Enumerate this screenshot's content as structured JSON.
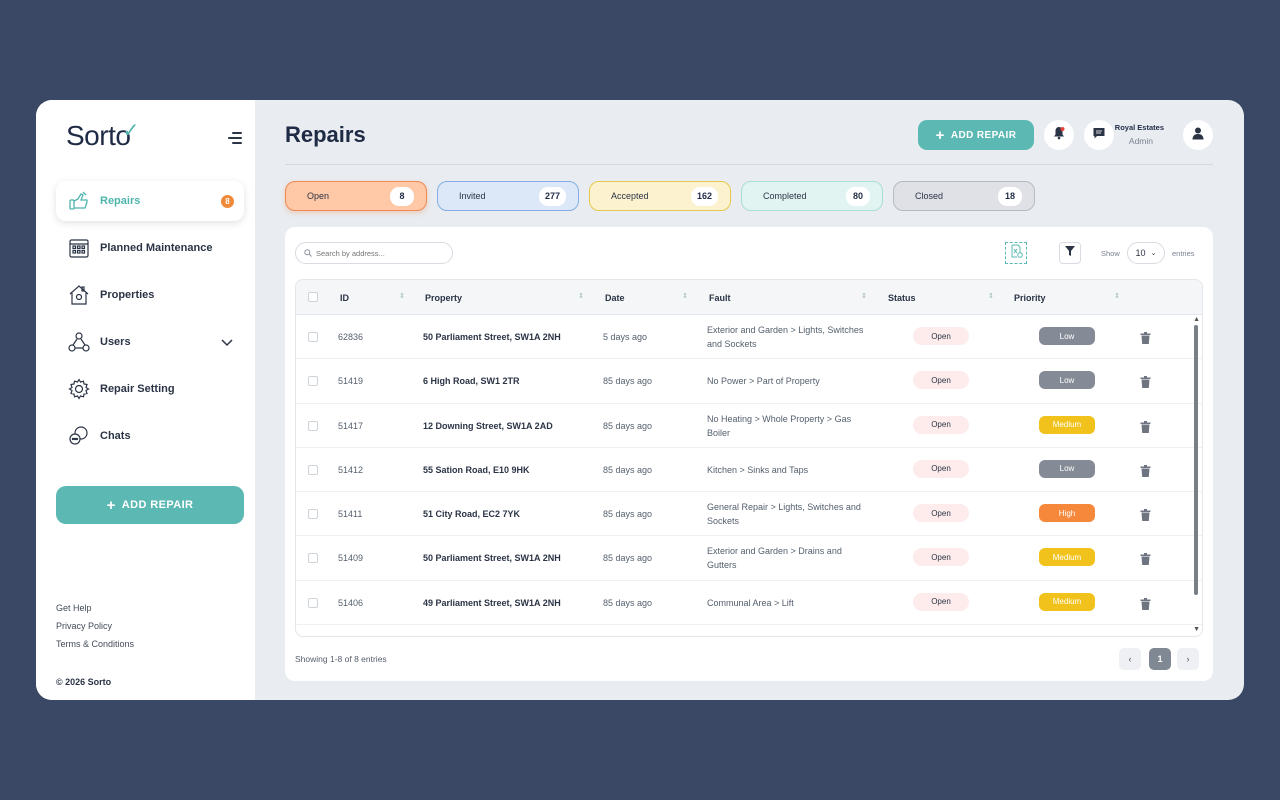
{
  "brand": {
    "name": "Sorto"
  },
  "sidebar": {
    "items": [
      {
        "label": "Repairs",
        "badge": "8",
        "icon": "repair-hand-icon"
      },
      {
        "label": "Planned Maintenance",
        "icon": "calendar-icon"
      },
      {
        "label": "Properties",
        "icon": "house-icon"
      },
      {
        "label": "Users",
        "icon": "users-network-icon"
      },
      {
        "label": "Repair Setting",
        "icon": "gear-icon"
      },
      {
        "label": "Chats",
        "icon": "chat-bubbles-icon"
      }
    ],
    "add_label": "ADD REPAIR",
    "footer": {
      "help": "Get Help",
      "privacy": "Privacy Policy",
      "terms": "Terms & Conditions"
    },
    "copyright": "© 2026 Sorto"
  },
  "header": {
    "title": "Repairs",
    "add_label": "ADD REPAIR",
    "user_name": "Royal Estates",
    "user_role": "Admin"
  },
  "stats": [
    {
      "label": "Open",
      "count": "8"
    },
    {
      "label": "Invited",
      "count": "277"
    },
    {
      "label": "Accepted",
      "count": "162"
    },
    {
      "label": "Completed",
      "count": "80"
    },
    {
      "label": "Closed",
      "count": "18"
    }
  ],
  "toolbar": {
    "search_placeholder": "Search by address...",
    "show_label": "Show",
    "page_size": "10",
    "entries_label": "entries"
  },
  "table": {
    "columns": [
      "ID",
      "Property",
      "Date",
      "Fault",
      "Status",
      "Priority"
    ],
    "rows": [
      {
        "id": "62836",
        "property": "50 Parliament Street, SW1A 2NH",
        "date": "5 days ago",
        "fault": "Exterior and Garden > Lights, Switches and Sockets",
        "status": "Open",
        "priority": "Low"
      },
      {
        "id": "51419",
        "property": "6 High Road, SW1 2TR",
        "date": "85 days ago",
        "fault": "No Power > Part of Property",
        "status": "Open",
        "priority": "Low"
      },
      {
        "id": "51417",
        "property": "12 Downing Street, SW1A 2AD",
        "date": "85 days ago",
        "fault": "No Heating > Whole Property > Gas Boiler",
        "status": "Open",
        "priority": "Medium"
      },
      {
        "id": "51412",
        "property": "55 Sation Road, E10 9HK",
        "date": "85 days ago",
        "fault": "Kitchen > Sinks and Taps",
        "status": "Open",
        "priority": "Low"
      },
      {
        "id": "51411",
        "property": "51 City Road, EC2 7YK",
        "date": "85 days ago",
        "fault": "General Repair > Lights, Switches and Sockets",
        "status": "Open",
        "priority": "High"
      },
      {
        "id": "51409",
        "property": "50 Parliament Street, SW1A 2NH",
        "date": "85 days ago",
        "fault": "Exterior and Garden > Drains and Gutters",
        "status": "Open",
        "priority": "Medium"
      },
      {
        "id": "51406",
        "property": "49 Parliament Street, SW1A 2NH",
        "date": "85 days ago",
        "fault": "Communal Area > Lift",
        "status": "Open",
        "priority": "Medium"
      }
    ]
  },
  "footer": {
    "showing": "Showing 1-8 of 8 entries",
    "current_page": "1",
    "prev": "‹",
    "next": "›"
  },
  "colors": {
    "accent": "#5cb8b2",
    "open_bg": "#ffc8a6",
    "open_border": "#f08a54",
    "invited_bg": "#dce8f8",
    "invited_border": "#84aee4",
    "accepted_bg": "#fdf2d0",
    "accepted_border": "#e8c84a",
    "completed_bg": "#e2f4f2",
    "completed_border": "#a8ded8",
    "closed_bg": "#dfe1e6",
    "closed_border": "#b6bac2",
    "priority_low": "#858b96",
    "priority_medium": "#f1c21b",
    "priority_high": "#f5883a"
  }
}
